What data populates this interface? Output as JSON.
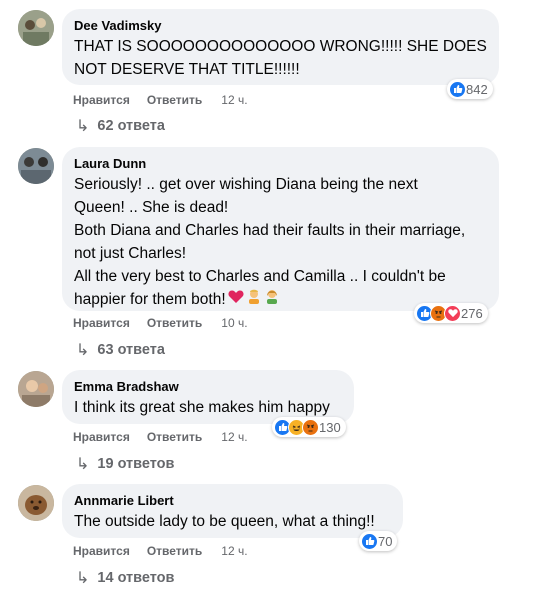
{
  "comments": [
    {
      "author": "Dee Vadimsky",
      "text": "THAT IS SOOOOOOOOOOOOOO WRONG!!!!! SHE DOES\nNOT DESERVE THAT TITLE!!!!!!",
      "like_label": "Нравится",
      "reply_label": "Ответить",
      "time": "12 ч.",
      "reaction_count": "842",
      "reaction_icons": [
        "like-icon"
      ],
      "replies": "62 ответа"
    },
    {
      "author": "Laura Dunn",
      "text": "Seriously! .. get over wishing Diana being the next\nQueen! .. She is dead!\nBoth Diana and Charles had their faults in their marriage,\nnot just Charles!\nAll the very best to Charles and Camilla .. I couldn't be\nhappier for them both!",
      "text_emojis": [
        "red-heart-emoji",
        "man-emoji",
        "woman-emoji"
      ],
      "like_label": "Нравится",
      "reply_label": "Ответить",
      "time": "10 ч.",
      "reaction_count": "276",
      "reaction_icons": [
        "like-icon",
        "angry-icon",
        "love-icon"
      ],
      "replies": "63 ответа"
    },
    {
      "author": "Emma Bradshaw",
      "text": "I think its great she makes him happy",
      "like_label": "Нравится",
      "reply_label": "Ответить",
      "time": "12 ч.",
      "reaction_count": "130",
      "reaction_icons": [
        "like-icon",
        "haha-icon",
        "angry-icon"
      ],
      "replies": "19 ответов"
    },
    {
      "author": "Annmarie Libert",
      "text": "The outside lady to be queen, what a thing!!",
      "like_label": "Нравится",
      "reply_label": "Ответить",
      "time": "12 ч.",
      "reaction_count": "70",
      "reaction_icons": [
        "like-icon"
      ],
      "replies": "14 ответов"
    }
  ],
  "colors": {
    "bubble": "#f0f2f5",
    "meta": "#65676b",
    "like_blue": "#1877f2",
    "angry_orange": "#e9710f",
    "love_red": "#f33e58",
    "haha_yellow": "#f7b125"
  }
}
